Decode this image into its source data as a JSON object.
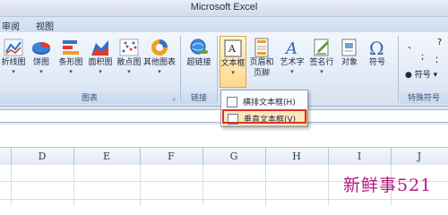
{
  "window": {
    "title": "Microsoft Excel"
  },
  "menu_tabs": [
    {
      "label": "审阅"
    },
    {
      "label": "视图"
    }
  ],
  "ribbon": {
    "charts_group": {
      "caption": "图表",
      "buttons": [
        {
          "label": "折线图",
          "icon": "line-chart-icon"
        },
        {
          "label": "饼图",
          "icon": "pie-chart-icon"
        },
        {
          "label": "条形图",
          "icon": "bar-chart-icon"
        },
        {
          "label": "面积图",
          "icon": "area-chart-icon"
        },
        {
          "label": "散点图",
          "icon": "scatter-chart-icon"
        },
        {
          "label": "其他图表",
          "icon": "other-charts-icon"
        }
      ]
    },
    "links_group": {
      "caption": "链接",
      "buttons": [
        {
          "label": "超链接",
          "icon": "hyperlink-icon"
        }
      ]
    },
    "text_group": {
      "buttons": [
        {
          "label": "文本框",
          "icon": "textbox-icon"
        },
        {
          "label": "页眉和",
          "label2": "页脚",
          "icon": "header-footer-icon"
        },
        {
          "label": "艺术字",
          "icon": "wordart-icon"
        },
        {
          "label": "签名行",
          "icon": "signature-line-icon"
        },
        {
          "label": "对象",
          "icon": "object-icon"
        },
        {
          "label": "符号",
          "icon": "omega-icon"
        }
      ]
    },
    "special_symbols_group": {
      "caption": "特殊符号",
      "symbol_button": "符号",
      "symbols": [
        "、",
        ";",
        "：",
        "?"
      ]
    }
  },
  "textbox_menu": {
    "items": [
      {
        "label": "横排文本框(H)"
      },
      {
        "label": "垂直文本框(V)"
      }
    ]
  },
  "columns": [
    "D",
    "E",
    "F",
    "G",
    "H",
    "I",
    "J"
  ],
  "watermark": "新鲜事521",
  "colors": {
    "highlight": "#e0302a",
    "menu_hover": "#fce8bd",
    "watermark": "#b3187d"
  }
}
